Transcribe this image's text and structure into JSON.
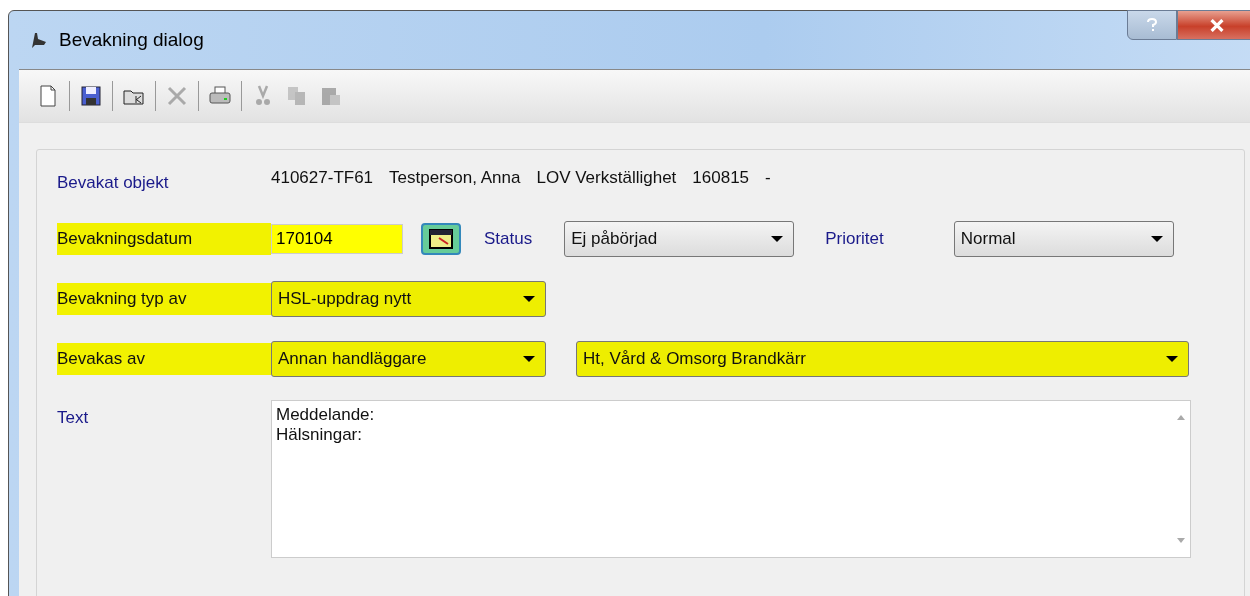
{
  "window": {
    "title": "Bevakning dialog"
  },
  "toolbar": [
    {
      "kind": "new",
      "disabled": false
    },
    {
      "kind": "save",
      "disabled": false
    },
    {
      "kind": "open",
      "disabled": false
    },
    {
      "kind": "delete",
      "disabled": true
    },
    {
      "kind": "print",
      "disabled": false
    },
    {
      "kind": "cut",
      "disabled": true
    },
    {
      "kind": "copy",
      "disabled": true
    },
    {
      "kind": "paste",
      "disabled": true
    }
  ],
  "object": {
    "label": "Bevakat objekt",
    "parts": [
      "410627-TF61",
      "Testperson, Anna",
      "LOV Verkställighet",
      "160815",
      "-"
    ]
  },
  "date": {
    "label": "Bevakningsdatum",
    "value": "170104",
    "highlighted": true
  },
  "status": {
    "label": "Status",
    "value": "Ej påbörjad"
  },
  "priority": {
    "label": "Prioritet",
    "value": "Normal"
  },
  "type": {
    "label": "Bevakning typ av",
    "value": "HSL-uppdrag nytt",
    "highlighted": true
  },
  "watched_by": {
    "label": "Bevakas av",
    "value": "Annan handläggare",
    "unit": "Ht, Vård & Omsorg Brandkärr",
    "highlighted": true
  },
  "text": {
    "label": "Text",
    "lines": [
      "Meddelande:",
      "Hälsningar:"
    ]
  }
}
